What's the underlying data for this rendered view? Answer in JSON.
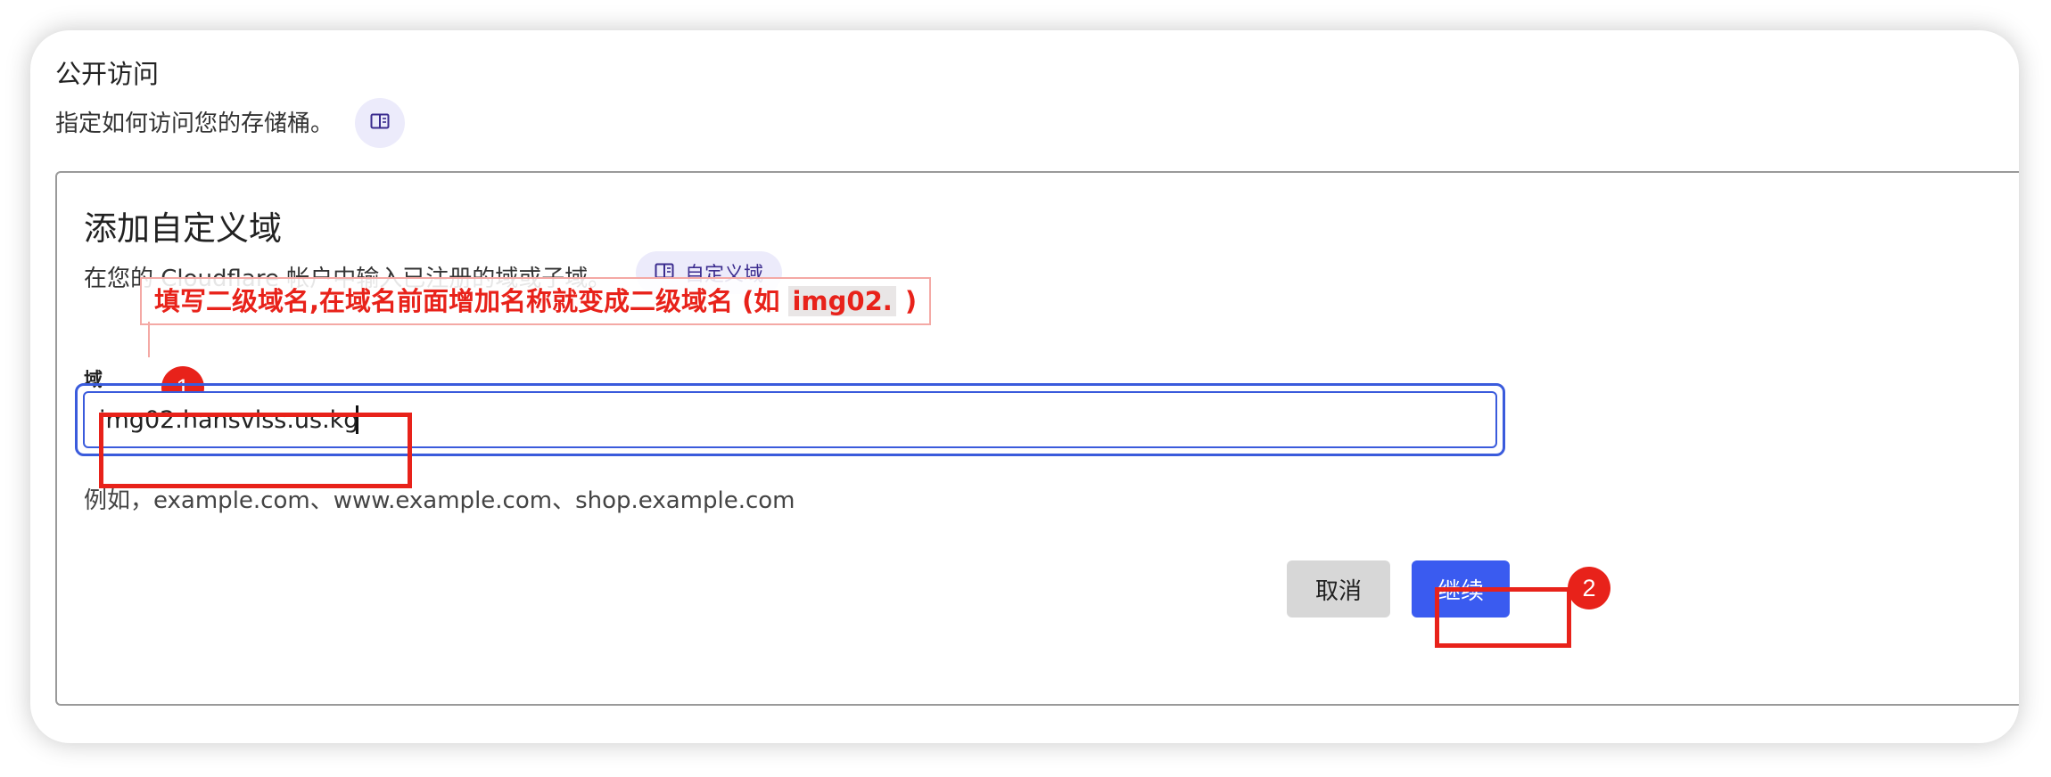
{
  "section": {
    "title": "公开访问",
    "description": "指定如何访问您的存储桶。",
    "doc_icon": "book-icon"
  },
  "custom_domain": {
    "title": "添加自定义域",
    "description": "在您的 Cloudflare 帐户中输入已注册的域或子域。",
    "doc_link_label": "自定义域",
    "field_label": "域",
    "input_value": "img02.hansvlss.us.kg",
    "hint": "例如，example.com、www.example.com、shop.example.com",
    "cancel_label": "取消",
    "continue_label": "继续"
  },
  "annotations": {
    "note_prefix": "填写二级域名,在域名前面增加名称就变成二级域名 (如 ",
    "note_highlight": "img02.",
    "note_suffix": " )",
    "badge_1": "1",
    "badge_2": "2",
    "accent_color": "#e8221a"
  },
  "colors": {
    "primary_button": "#3a5bf0",
    "input_border": "#3a5bdc",
    "doc_chip_bg": "#ecebfb"
  }
}
